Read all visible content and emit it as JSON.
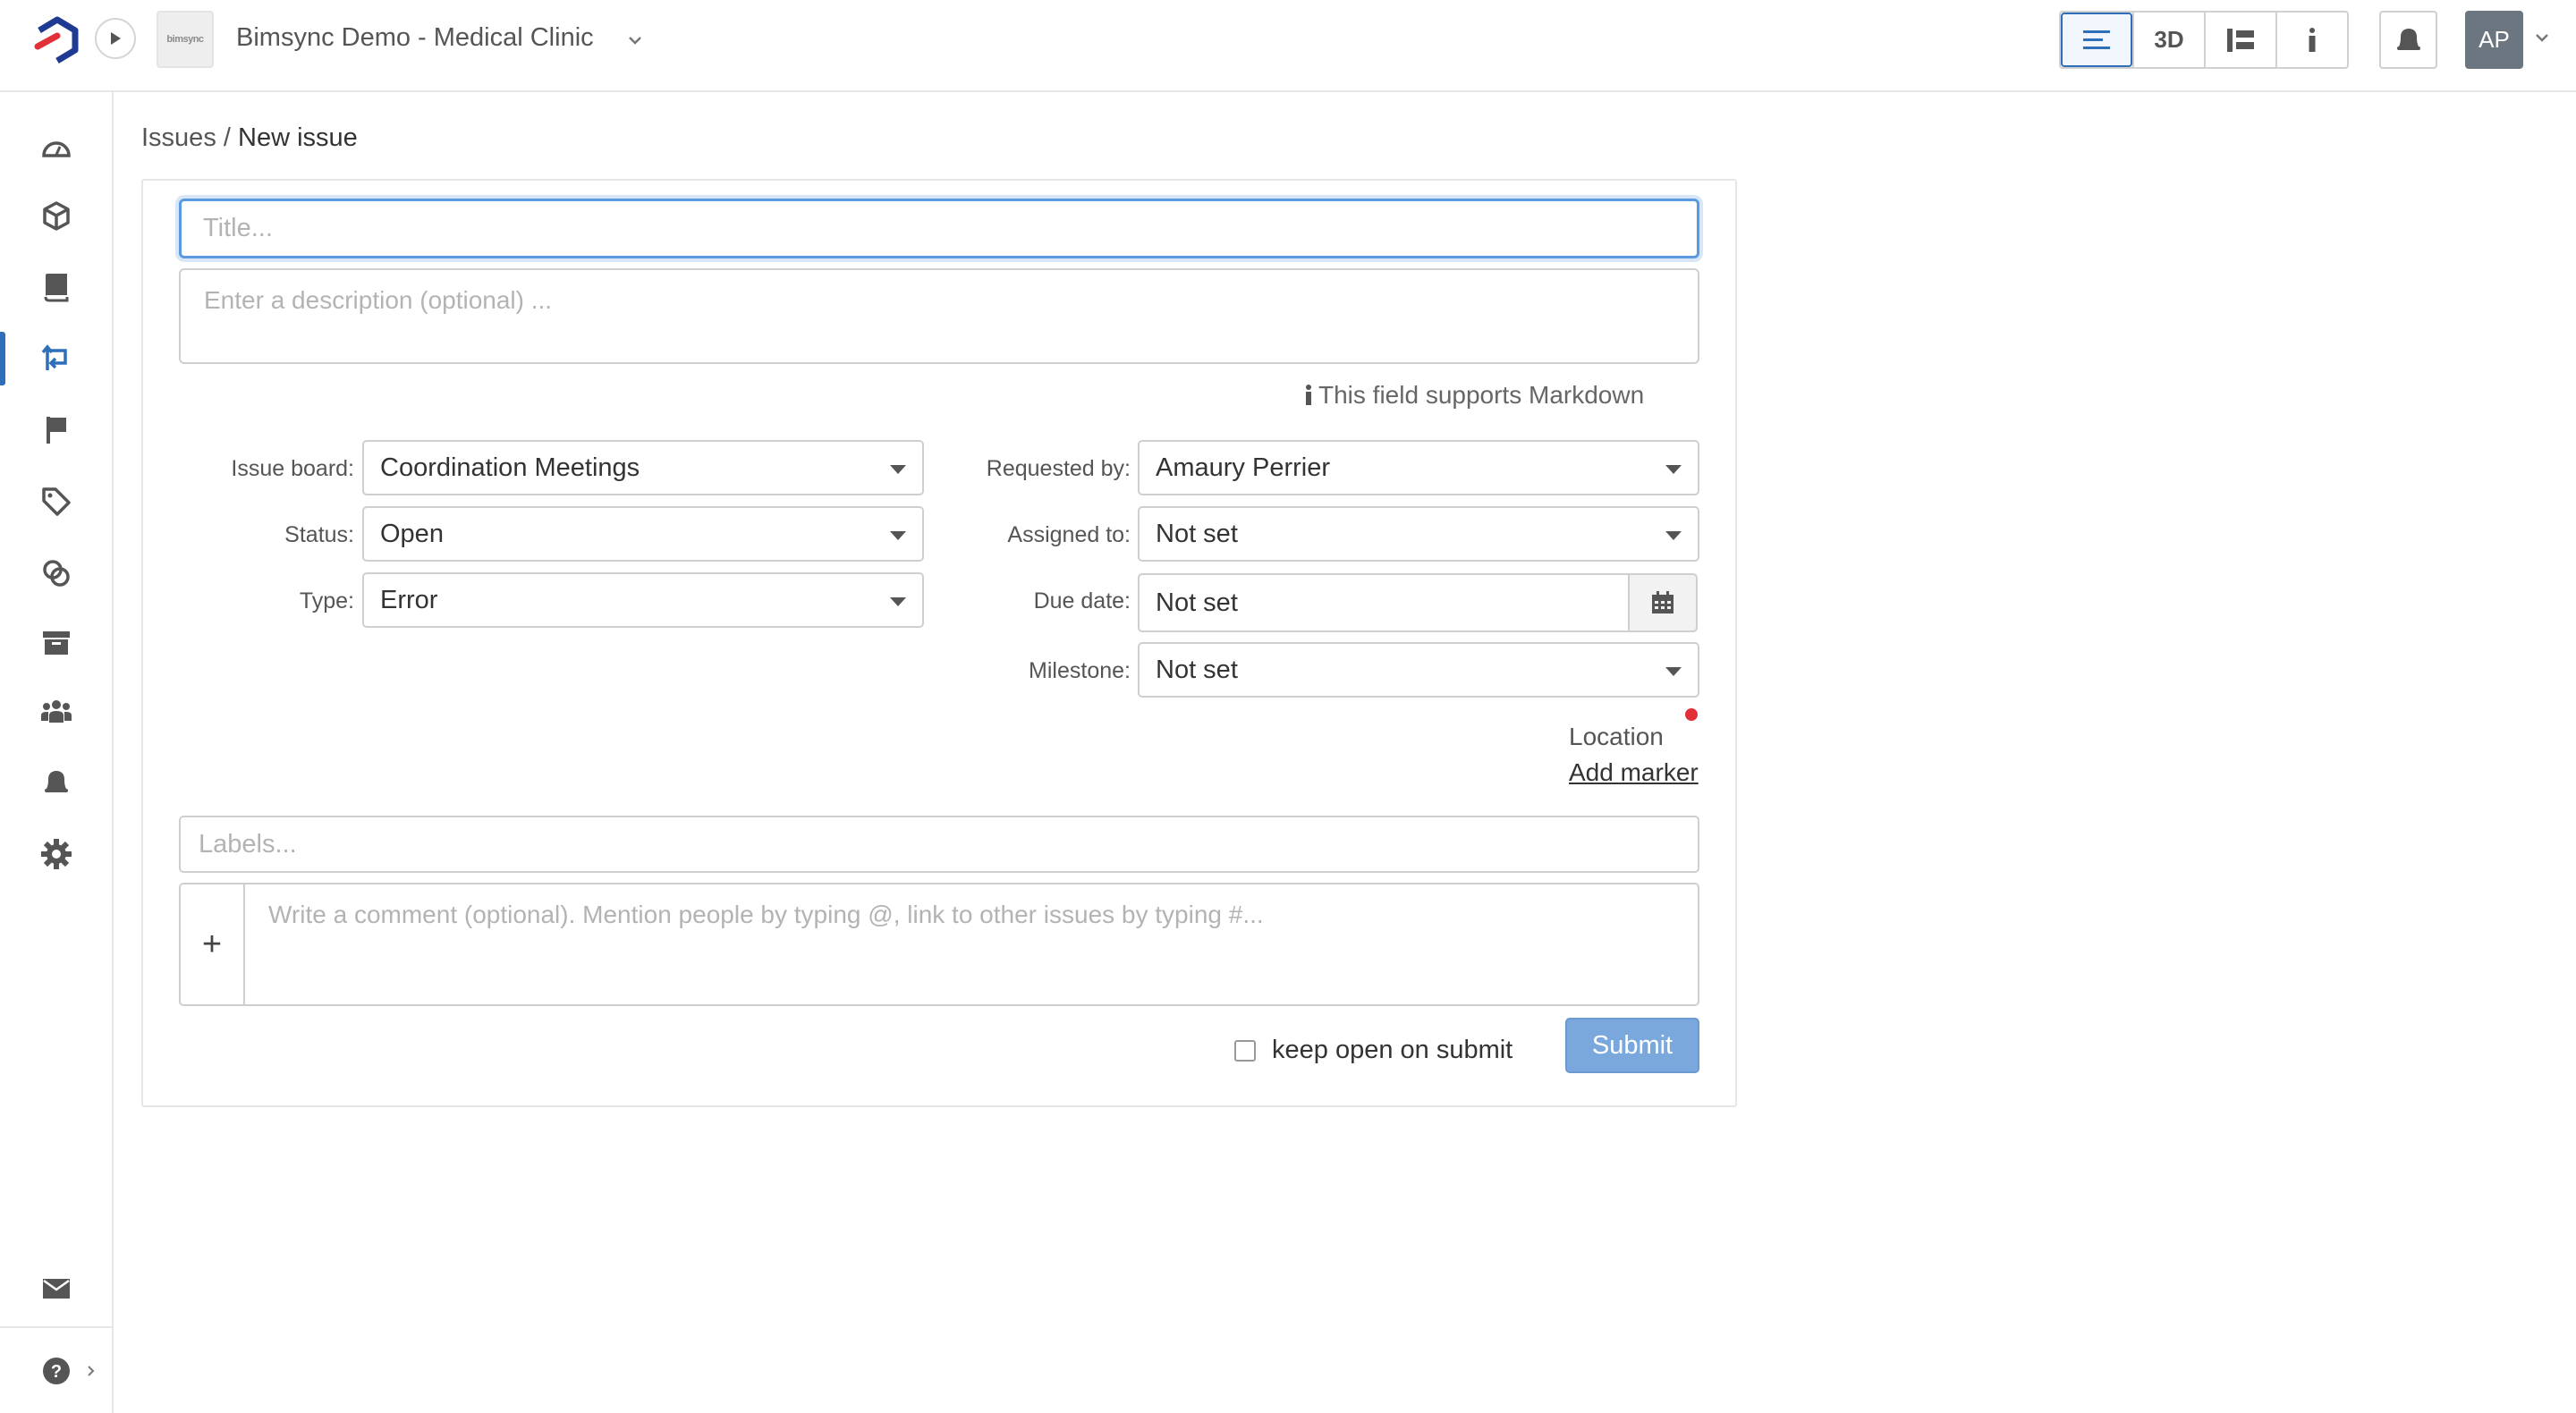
{
  "header": {
    "project_name": "Bimsync Demo - Medical Clinic",
    "project_thumb_text": "bimsync",
    "view_buttons": [
      {
        "name": "list-view",
        "label": "",
        "icon": "list-icon",
        "active": true
      },
      {
        "name": "3d-view",
        "label": "3D",
        "icon": "",
        "active": false
      },
      {
        "name": "tree-view",
        "label": "",
        "icon": "tree-icon",
        "active": false
      },
      {
        "name": "info-view",
        "label": "i",
        "icon": "info-icon",
        "active": false
      }
    ],
    "avatar_initials": "AP"
  },
  "sidebar": {
    "items": [
      {
        "name": "dashboard",
        "icon": "dashboard-icon",
        "active": false
      },
      {
        "name": "models",
        "icon": "cube-icon",
        "active": false
      },
      {
        "name": "libraries",
        "icon": "book-icon",
        "active": false
      },
      {
        "name": "issues",
        "icon": "issues-icon",
        "active": true
      },
      {
        "name": "milestones",
        "icon": "flag-icon",
        "active": false
      },
      {
        "name": "labels",
        "icon": "tag-icon",
        "active": false
      },
      {
        "name": "links",
        "icon": "link-icon",
        "active": false
      },
      {
        "name": "archive",
        "icon": "archive-icon",
        "active": false
      },
      {
        "name": "members",
        "icon": "users-icon",
        "active": false
      },
      {
        "name": "notifications",
        "icon": "bell-icon",
        "active": false
      },
      {
        "name": "settings",
        "icon": "gear-icon",
        "active": false
      }
    ],
    "bottom": [
      {
        "name": "inbox",
        "icon": "envelope-icon"
      },
      {
        "name": "help",
        "icon": "help-icon"
      }
    ]
  },
  "breadcrumb": {
    "parent": "Issues",
    "separator": "/",
    "current": "New issue"
  },
  "form": {
    "title_placeholder": "Title...",
    "description_placeholder": "Enter a description (optional) ...",
    "markdown_note": "This field supports Markdown",
    "fields": {
      "issue_board": {
        "label": "Issue board:",
        "value": "Coordination Meetings"
      },
      "status": {
        "label": "Status:",
        "value": "Open"
      },
      "type": {
        "label": "Type:",
        "value": "Error"
      },
      "requested_by": {
        "label": "Requested by:",
        "value": "Amaury Perrier"
      },
      "assigned_to": {
        "label": "Assigned to:",
        "value": "Not set"
      },
      "due_date": {
        "label": "Due date:",
        "value": "Not set"
      },
      "milestone": {
        "label": "Milestone:",
        "value": "Not set"
      }
    },
    "location_label": "Location",
    "add_marker": "Add marker",
    "labels_placeholder": "Labels...",
    "comment_placeholder": "Write a comment (optional). Mention people by typing @, link to other issues by typing #...",
    "comment_add": "+",
    "keep_open_label": "keep open on submit",
    "keep_open_checked": false,
    "submit_label": "Submit"
  },
  "colors": {
    "accent": "#2f6fba",
    "submit": "#7ba8dc",
    "location_dot": "#e0303a"
  }
}
